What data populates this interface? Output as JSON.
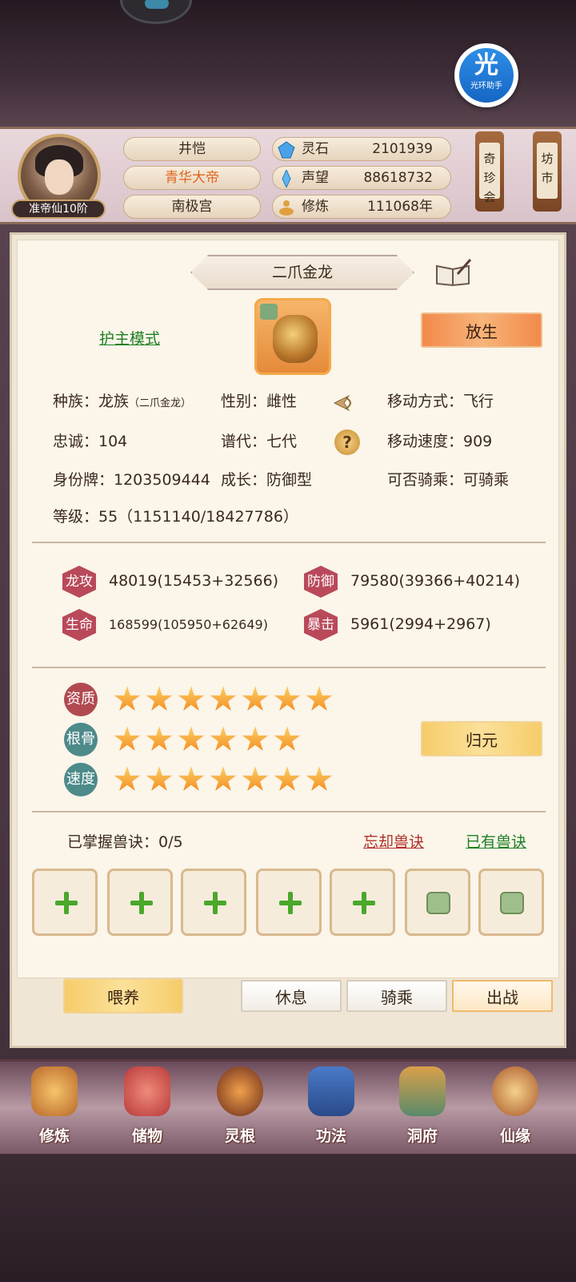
{
  "helper": {
    "big": "光",
    "small": "光环助手"
  },
  "player": {
    "rank": "准帝仙10阶",
    "names": [
      "井恺",
      "青华大帝",
      "南极宫"
    ],
    "resources": [
      {
        "icon": "spirit-stone-icon",
        "label": "灵石",
        "value": "2101939"
      },
      {
        "icon": "prestige-icon",
        "label": "声望",
        "value": "88618732"
      },
      {
        "icon": "cultivation-icon",
        "label": "修炼",
        "value": "111068年"
      }
    ]
  },
  "side_scrolls": [
    {
      "label": "奇珍会"
    },
    {
      "label": "坊市"
    }
  ],
  "pet": {
    "title": "二爪金龙",
    "mode_link": "护主模式",
    "release_btn": "放生",
    "info": {
      "race_label": "种族：龙族",
      "race_sub": "（二爪金龙）",
      "gender": "性别：雌性",
      "move_type": "移动方式：飞行",
      "loyalty": "忠诚：104",
      "generation": "谱代：七代",
      "move_speed": "移动速度：909",
      "id_tag": "身份牌：1203509444",
      "growth": "成长：防御型",
      "rideable": "可否骑乘：可骑乘",
      "level": "等级：55（1151140/18427786）"
    },
    "stats": [
      {
        "badge": "龙攻",
        "value": "48019(15453+32566)"
      },
      {
        "badge": "防御",
        "value": "79580(39366+40214)"
      },
      {
        "badge": "生命",
        "value": "168599(105950+62649)"
      },
      {
        "badge": "暴击",
        "value": "5961(2994+2967)"
      }
    ],
    "aptitudes": [
      {
        "badge": "资质",
        "stars": 7
      },
      {
        "badge": "根骨",
        "stars": 6
      },
      {
        "badge": "速度",
        "stars": 7
      }
    ],
    "guiyuan_btn": "归元",
    "skill_label": "已掌握兽诀：0/5",
    "forget_link": "忘却兽诀",
    "owned_link": "已有兽诀",
    "slots": [
      "plus",
      "plus",
      "plus",
      "plus",
      "plus",
      "locked",
      "locked"
    ]
  },
  "actions": {
    "feed": "喂养",
    "rest": "休息",
    "ride": "骑乘",
    "battle": "出战"
  },
  "nav": [
    "修炼",
    "储物",
    "灵根",
    "功法",
    "洞府",
    "仙缘"
  ],
  "colors": {
    "accent_orange": "#f28a4a",
    "link_green": "#1e7f22",
    "link_red": "#b03028"
  }
}
